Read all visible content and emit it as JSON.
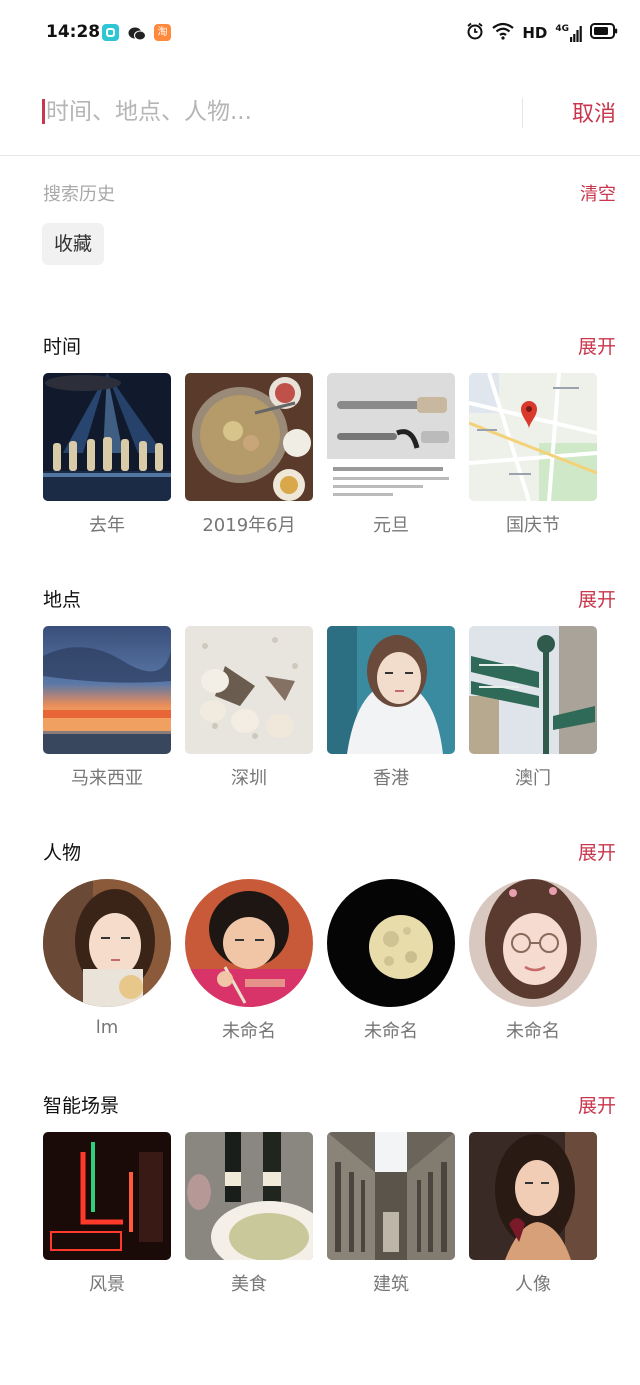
{
  "status_bar": {
    "time": "14:28",
    "app_badge_taobao": "淘",
    "hd_label": "HD",
    "signal_label": "4G",
    "icons": [
      "app-icon",
      "wechat-icon",
      "taobao-icon",
      "alarm-icon",
      "wifi-icon",
      "signal-icon",
      "battery-icon"
    ]
  },
  "search": {
    "placeholder": "时间、地点、人物...",
    "value": "",
    "cancel_label": "取消"
  },
  "history": {
    "label": "搜索历史",
    "clear_label": "清空",
    "items": [
      "收藏"
    ]
  },
  "colors": {
    "accent": "#c8374d",
    "muted_text": "#a9a9a9",
    "caption_text": "#777777",
    "chip_bg": "#f1f1f1"
  },
  "sections": [
    {
      "title": "时间",
      "expand_label": "展开",
      "items": [
        {
          "caption": "去年"
        },
        {
          "caption": "2019年6月"
        },
        {
          "caption": "元旦"
        },
        {
          "caption": "国庆节"
        }
      ]
    },
    {
      "title": "地点",
      "expand_label": "展开",
      "items": [
        {
          "caption": "马来西亚"
        },
        {
          "caption": "深圳"
        },
        {
          "caption": "香港"
        },
        {
          "caption": "澳门"
        }
      ]
    },
    {
      "title": "人物",
      "expand_label": "展开",
      "items": [
        {
          "caption": "lm"
        },
        {
          "caption": "未命名"
        },
        {
          "caption": "未命名"
        },
        {
          "caption": "未命名"
        }
      ]
    },
    {
      "title": "智能场景",
      "expand_label": "展开",
      "items": [
        {
          "caption": "风景"
        },
        {
          "caption": "美食"
        },
        {
          "caption": "建筑"
        },
        {
          "caption": "人像"
        }
      ]
    }
  ]
}
